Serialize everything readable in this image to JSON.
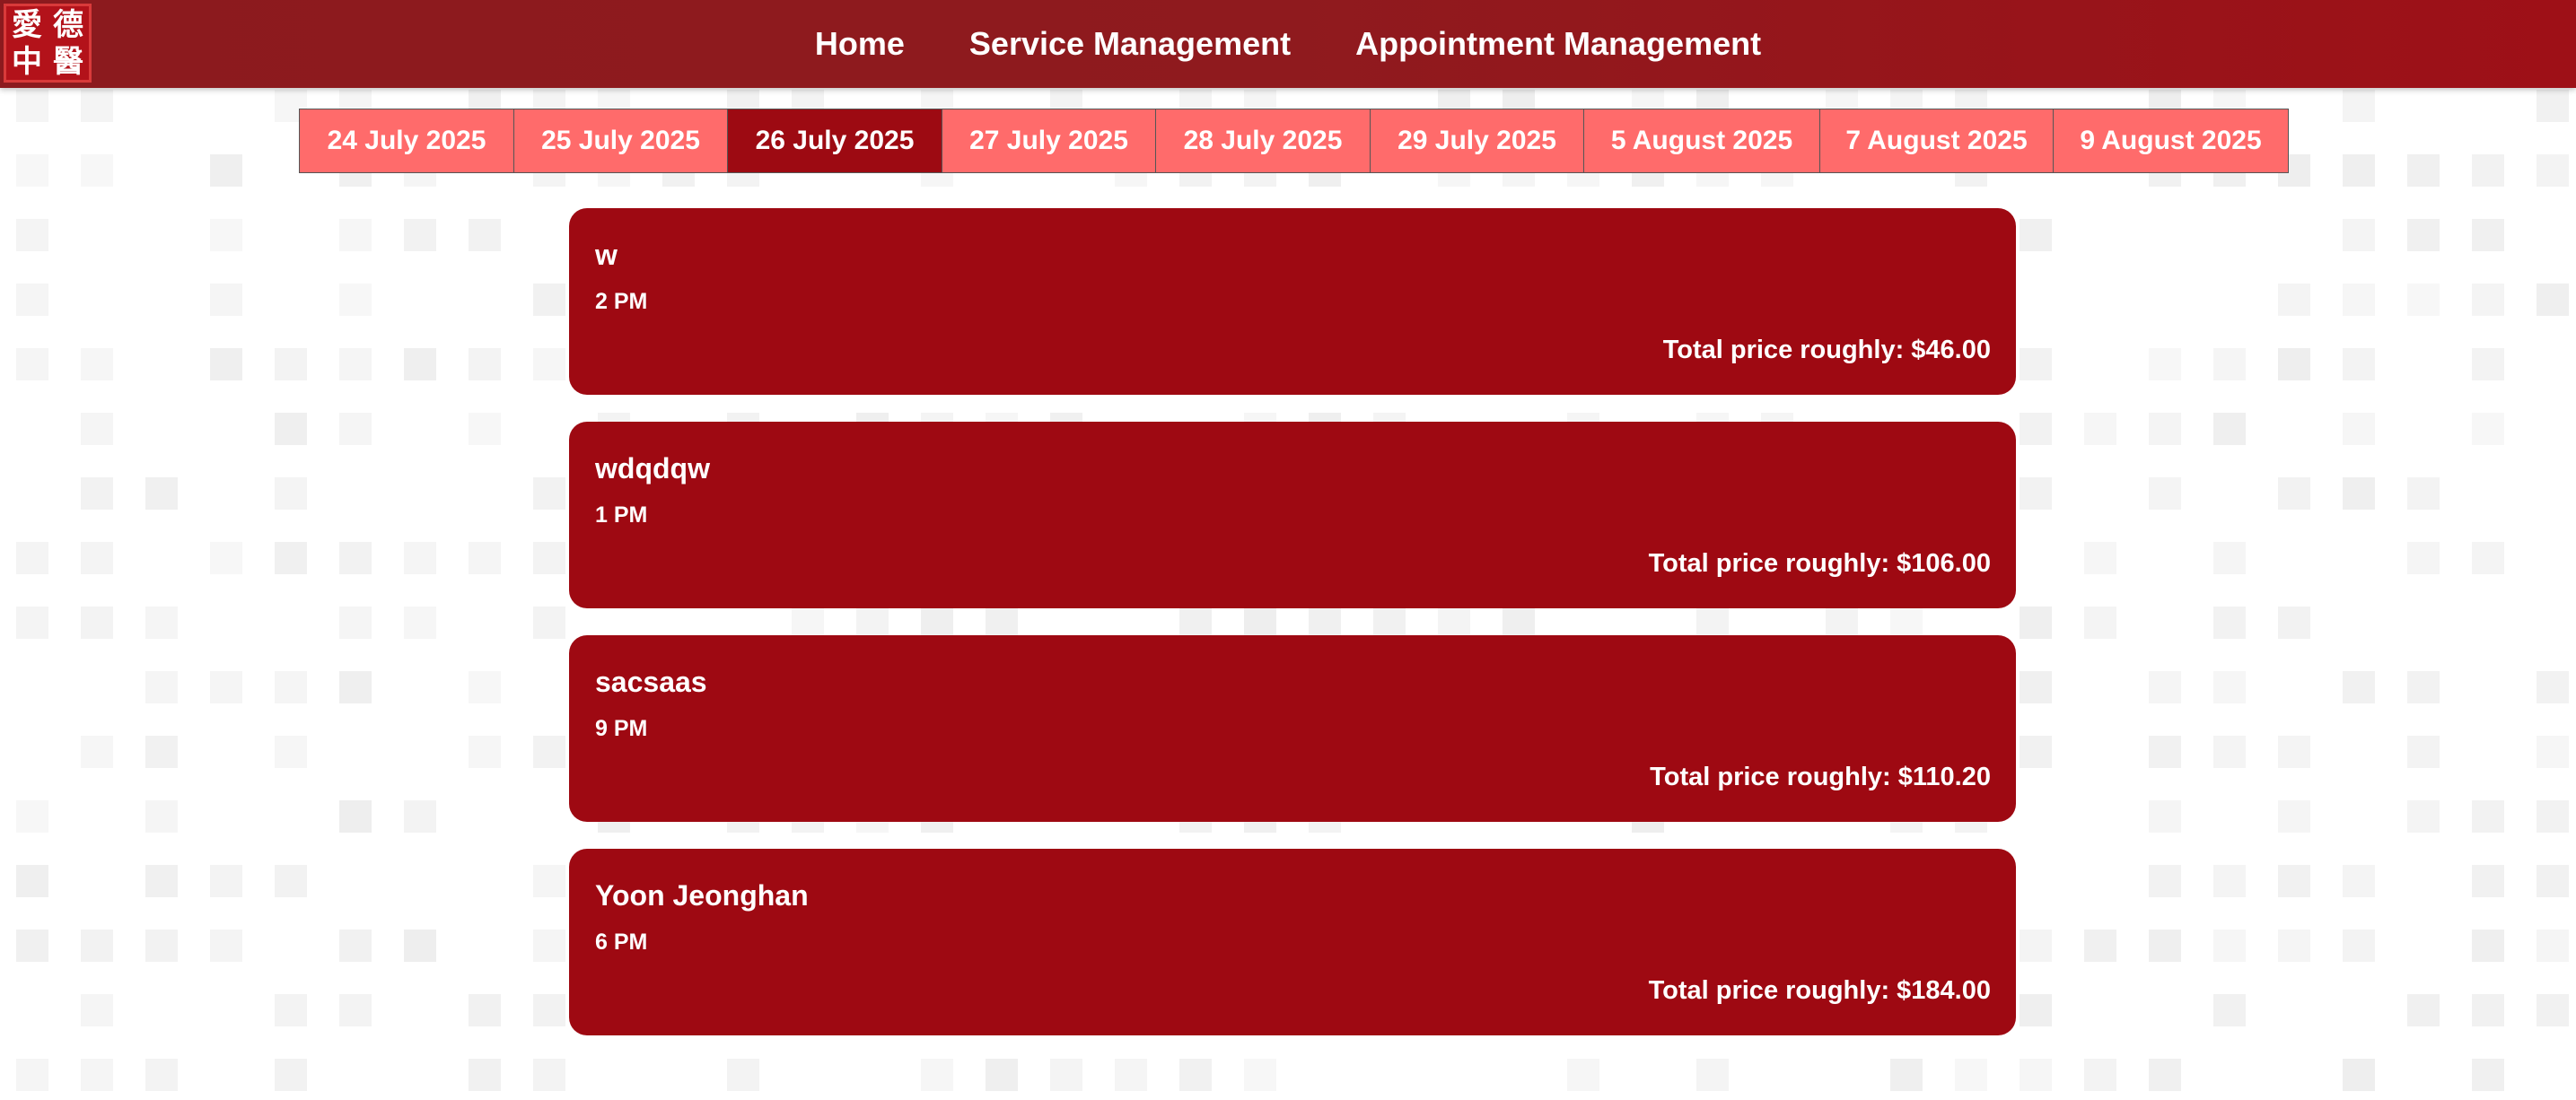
{
  "logo": {
    "chars": [
      "愛",
      "德",
      "中",
      "醫"
    ]
  },
  "nav": {
    "items": [
      {
        "label": "Home"
      },
      {
        "label": "Service Management"
      },
      {
        "label": "Appointment Management"
      }
    ]
  },
  "dates": {
    "selected": "26 July 2025",
    "tabs": [
      {
        "label": "24 July 2025"
      },
      {
        "label": "25 July 2025"
      },
      {
        "label": "26 July 2025"
      },
      {
        "label": "27 July 2025"
      },
      {
        "label": "28 July 2025"
      },
      {
        "label": "29 July 2025"
      },
      {
        "label": "5 August 2025"
      },
      {
        "label": "7 August 2025"
      },
      {
        "label": "9 August 2025"
      }
    ]
  },
  "appointments": [
    {
      "name": "w",
      "time": "2 PM",
      "price": "Total price roughly: $46.00"
    },
    {
      "name": "wdqdqw",
      "time": "1 PM",
      "price": "Total price roughly: $106.00"
    },
    {
      "name": "sacsaas",
      "time": "9 PM",
      "price": "Total price roughly: $110.20"
    },
    {
      "name": "Yoon Jeonghan",
      "time": "6 PM",
      "price": "Total price roughly: $184.00"
    }
  ],
  "colors": {
    "header": "#8f1a1e",
    "card": "#9e0912",
    "tab": "#ff6b6b",
    "tab_active": "#9d0a12"
  }
}
